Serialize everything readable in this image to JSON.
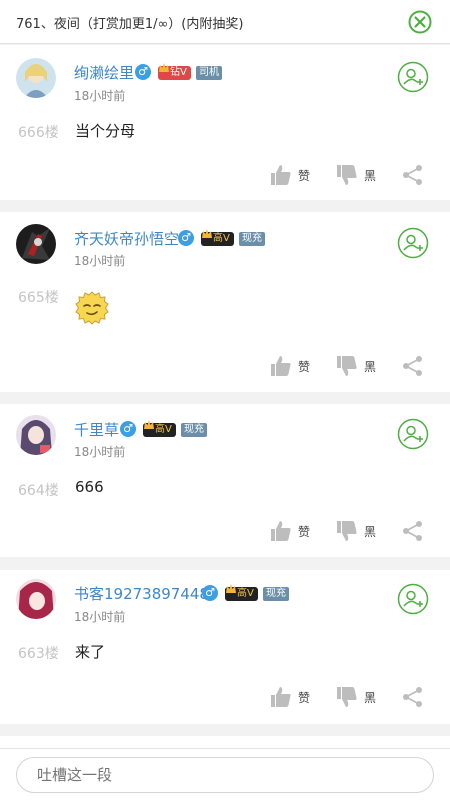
{
  "header": {
    "title": "761、夜间（打赏加更1/∞）(内附抽奖)"
  },
  "comments": [
    {
      "user": "绚濑绘里",
      "gender": "♂",
      "vip": "钻V",
      "tag": "司机",
      "time": "18小时前",
      "floor": "666楼",
      "text": "当个分母",
      "like_label": "赞",
      "dislike_label": "黑"
    },
    {
      "user": "齐天妖帝孙悟空",
      "gender": "♂",
      "vip": "高V",
      "tag": "现充",
      "time": "18小时前",
      "floor": "665楼",
      "text": "",
      "emoji": "sly-face-emoji",
      "like_label": "赞",
      "dislike_label": "黑"
    },
    {
      "user": "千里草",
      "gender": "♂",
      "vip": "高V",
      "tag": "现充",
      "time": "18小时前",
      "floor": "664楼",
      "text": "666",
      "like_label": "赞",
      "dislike_label": "黑"
    },
    {
      "user": "书客19273897448",
      "gender": "♂",
      "vip": "高V",
      "tag": "现充",
      "time": "18小时前",
      "floor": "663楼",
      "text": "来了",
      "like_label": "赞",
      "dislike_label": "黑"
    }
  ],
  "composer": {
    "placeholder": "吐槽这一段"
  },
  "colors": {
    "accent": "#4caf3f",
    "username": "#3d87c9",
    "gender": "#3d9fe3",
    "vip_red": "#e04848",
    "vip_dark": "#222222"
  },
  "icons": [
    "close-icon",
    "follow-icon",
    "thumbs-up-icon",
    "thumbs-down-icon",
    "share-icon"
  ]
}
